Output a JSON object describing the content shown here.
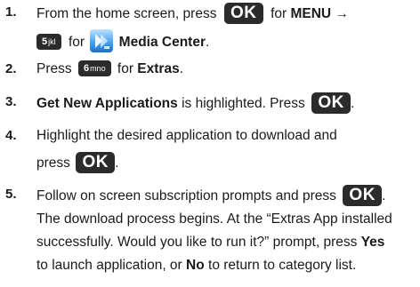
{
  "steps": [
    {
      "num": "1.",
      "line1": {
        "a": "From the home screen, press",
        "key": "OK",
        "b": "for",
        "bold": "MENU",
        "arrow": "→"
      },
      "line2": {
        "key_digit": "5",
        "key_letters": "jkl",
        "a": "for",
        "bold": "Media Center",
        "end": "."
      }
    },
    {
      "num": "2.",
      "line1": {
        "a": "Press",
        "key_digit": "6",
        "key_letters": "mno",
        "b": "for",
        "bold": "Extras",
        "end": "."
      }
    },
    {
      "num": "3.",
      "line1": {
        "bold": "Get New Applications",
        "a": "is highlighted. Press",
        "key": "OK",
        "end": "."
      }
    },
    {
      "num": "4.",
      "line1": "Highlight the desired application to download and",
      "line2": {
        "a": "press",
        "key": "OK",
        "end": "."
      }
    },
    {
      "num": "5.",
      "line1": {
        "a": "Follow on screen subscription prompts and press",
        "key": "OK",
        "end": "."
      },
      "line2": "The download process begins. At the “Extras App installed",
      "line3": {
        "a": "successfully. Would you like to run it?” prompt, press",
        "bold": "Yes"
      },
      "line4": {
        "a": "to launch application, or",
        "bold": "No",
        "b": "to return to category list."
      }
    }
  ],
  "icons": {
    "media_center": "media-center-icon"
  }
}
